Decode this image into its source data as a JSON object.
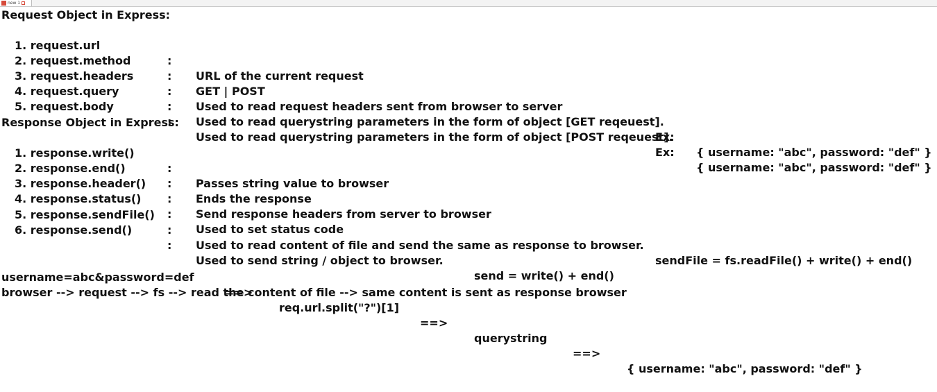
{
  "tab": {
    "label": "new 1",
    "accent": "#d64a3a"
  },
  "request_section": {
    "heading": "Request Object in Express:",
    "items": [
      {
        "name": "1. request.url",
        "sep": ":",
        "desc": "URL of the current request"
      },
      {
        "name": "2. request.method",
        "sep": ":",
        "desc": "GET | POST"
      },
      {
        "name": "3. request.headers",
        "sep": ":",
        "desc": "Used to read request headers sent from browser to server"
      },
      {
        "name": "4. request.query",
        "sep": ":",
        "desc": "Used to read querystring parameters in the form of object [GET reqeuest].",
        "ex": "Ex:",
        "obj": "{ username: \"abc\", password: \"def\" }"
      },
      {
        "name": "5. request.body",
        "sep": ":",
        "desc": "Used to read querystring parameters in the form of object [POST reqeuest].",
        "ex": "Ex:",
        "obj": "{ username: \"abc\", password: \"def\" }"
      }
    ]
  },
  "response_section": {
    "heading": "Response Object in Express:",
    "items": [
      {
        "name": "1. response.write()",
        "sep": ":",
        "desc": "Passes string value to browser"
      },
      {
        "name": "2. response.end()",
        "sep": ":",
        "desc": "Ends the response"
      },
      {
        "name": "3. response.header()",
        "sep": ":",
        "desc": "Send response headers from server to browser"
      },
      {
        "name": "4. response.status()",
        "sep": ":",
        "desc": "Used to set status code"
      },
      {
        "name": "5. response.sendFile()",
        "sep": ":",
        "desc": "Used to read content of file and send the same as response to browser.",
        "extra": "sendFile = fs.readFile() + write() + end()"
      },
      {
        "name": "6. response.send()",
        "sep": ":",
        "desc": "Used to send string / object to browser.",
        "extra": "send = write() + end()"
      }
    ]
  },
  "notes": {
    "query_flow": {
      "input": "username=abc&password=def",
      "arrow1": "==>",
      "step1": "req.url.split(\"?\")[1]",
      "arrow2": "==>",
      "step2": "querystring",
      "arrow3": "==>",
      "result": "{ username: \"abc\", password: \"def\" }"
    },
    "file_flow": "browser --> request --> fs --> read the content of file --> same content is sent as response browser"
  }
}
